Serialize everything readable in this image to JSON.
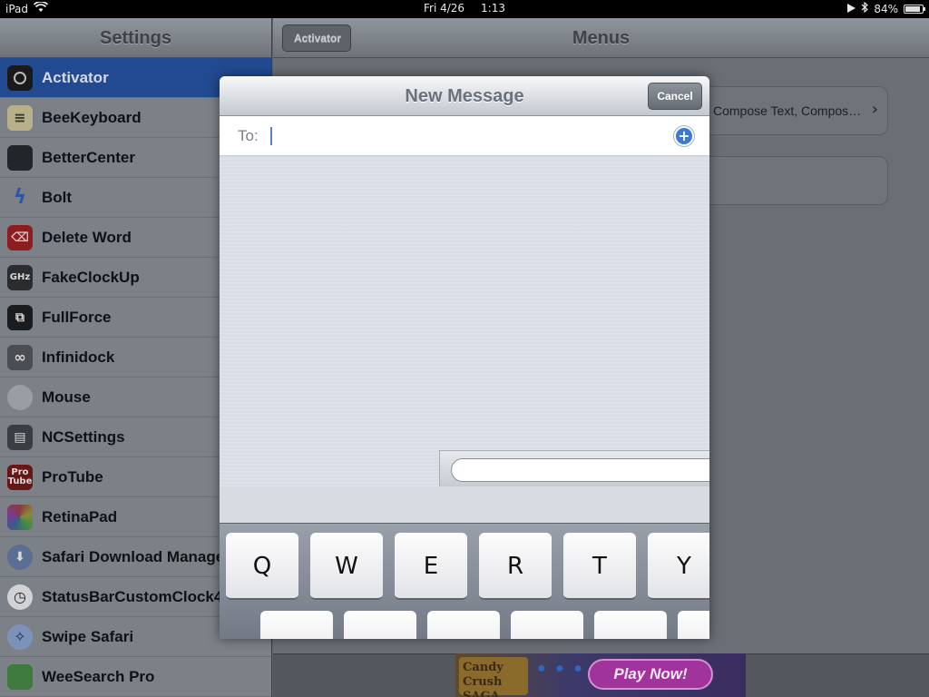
{
  "status_bar": {
    "device": "iPad",
    "date": "Fri 4/26",
    "time": "1:13",
    "battery": "84%"
  },
  "settings_pane": {
    "title": "Settings",
    "items": [
      {
        "label": "Activator",
        "icon": "activator-icon",
        "selected": true
      },
      {
        "label": "BeeKeyboard",
        "icon": "bee-keyboard-icon"
      },
      {
        "label": "BetterCenter",
        "icon": "better-center-icon"
      },
      {
        "label": "Bolt",
        "icon": "bolt-icon"
      },
      {
        "label": "Delete Word",
        "icon": "delete-word-icon"
      },
      {
        "label": "FakeClockUp",
        "icon": "ghz-icon",
        "icon_text": "GHz"
      },
      {
        "label": "FullForce",
        "icon": "fullforce-icon"
      },
      {
        "label": "Infinidock",
        "icon": "infinidock-icon"
      },
      {
        "label": "Mouse",
        "icon": "mouse-icon"
      },
      {
        "label": "NCSettings",
        "icon": "ncsettings-icon"
      },
      {
        "label": "ProTube",
        "icon": "protube-icon",
        "icon_text": "Pro Tube"
      },
      {
        "label": "RetinaPad",
        "icon": "retinapad-icon"
      },
      {
        "label": "Safari Download Manage",
        "icon": "download-icon"
      },
      {
        "label": "StatusBarCustomClock4",
        "icon": "clock-icon"
      },
      {
        "label": "Swipe Safari",
        "icon": "swipe-safari-icon"
      },
      {
        "label": "WeeSearch Pro",
        "icon": "weesearch-icon"
      }
    ]
  },
  "detail_pane": {
    "back_label": "Activator",
    "title": "Menus",
    "row_value": "Compose Text, Compos…"
  },
  "modal": {
    "title": "New Message",
    "cancel_label": "Cancel",
    "to_label": "To:",
    "to_value": ""
  },
  "keyboard": {
    "row1": [
      "Q",
      "W",
      "E",
      "R",
      "T",
      "Y"
    ]
  },
  "ad": {
    "logo_text": "Candy Crush SAGA",
    "cta_label": "Play Now!"
  },
  "colors": {
    "selected_row": "#224a91",
    "accent_blue": "#3a79d8",
    "ad_button": "#a0349c"
  }
}
